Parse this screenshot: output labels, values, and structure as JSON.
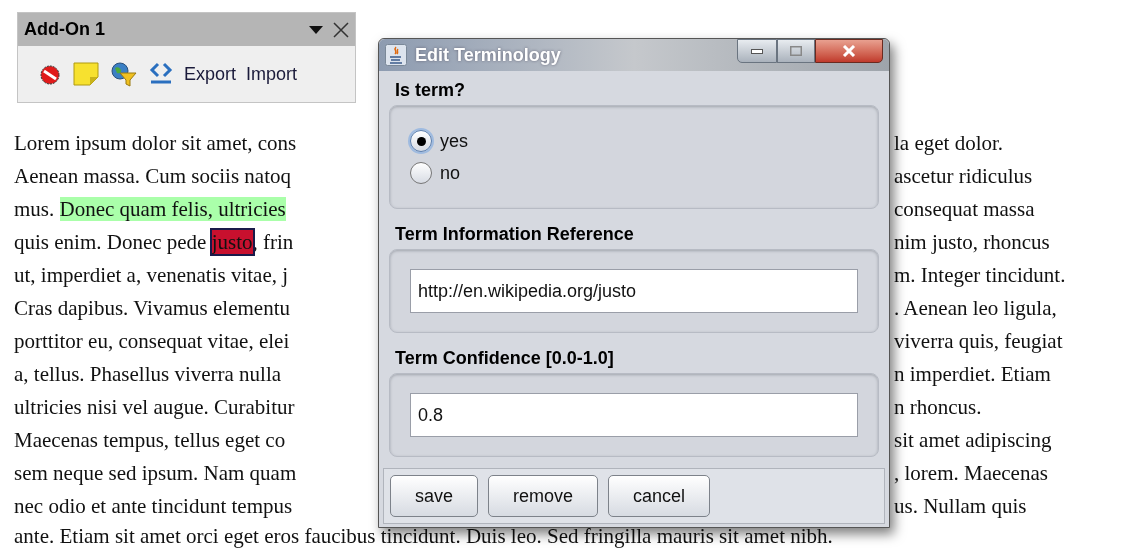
{
  "toolbar": {
    "title": "Add-On 1",
    "text_buttons": [
      "Export",
      "Import"
    ]
  },
  "document": {
    "lines": [
      {
        "segments": [
          {
            "kind": "plain",
            "text": "Lorem ipsum dolor sit amet, cons"
          }
        ],
        "right": "la eget dolor."
      },
      {
        "segments": [
          {
            "kind": "plain",
            "text": "Aenean massa. Cum sociis natoq"
          }
        ],
        "right": "ascetur ridiculus"
      },
      {
        "segments": [
          {
            "kind": "plain",
            "text": "mus. "
          },
          {
            "kind": "highlight",
            "text": "Donec quam felis, ultricies"
          }
        ],
        "right": "consequat massa"
      },
      {
        "segments": [
          {
            "kind": "plain",
            "text": "quis enim. Donec pede "
          },
          {
            "kind": "selected",
            "text": "justo"
          },
          {
            "kind": "plain",
            "text": ", frin"
          }
        ],
        "right": "nim justo, rhoncus"
      },
      {
        "segments": [
          {
            "kind": "plain",
            "text": "ut, imperdiet a, venenatis vitae, j"
          }
        ],
        "right": "m. Integer tincidunt."
      },
      {
        "segments": [
          {
            "kind": "plain",
            "text": "Cras dapibus. Vivamus elementu"
          }
        ],
        "right": ". Aenean leo ligula,"
      },
      {
        "segments": [
          {
            "kind": "plain",
            "text": "porttitor eu, consequat vitae, elei"
          }
        ],
        "right": "viverra quis, feugiat"
      },
      {
        "segments": [
          {
            "kind": "plain",
            "text": "a, tellus. Phasellus viverra nulla"
          }
        ],
        "right": "n imperdiet. Etiam"
      },
      {
        "segments": [
          {
            "kind": "plain",
            "text": "ultricies nisi vel augue. Curabitur"
          }
        ],
        "right": "n rhoncus."
      },
      {
        "segments": [
          {
            "kind": "plain",
            "text": "Maecenas tempus, tellus eget co"
          }
        ],
        "right": "sit amet adipiscing"
      },
      {
        "segments": [
          {
            "kind": "plain",
            "text": "sem neque sed ipsum. Nam quam"
          }
        ],
        "right": ", lorem. Maecenas"
      },
      {
        "segments": [
          {
            "kind": "plain",
            "text": "nec odio et ante tincidunt tempus"
          }
        ],
        "right": "us. Nullam quis"
      },
      {
        "segments": [
          {
            "kind": "plain",
            "text": "ante. Etiam sit amet orci eget eros faucibus tincidunt. Duis leo. Sed fringilla mauris sit amet nibh."
          }
        ]
      }
    ]
  },
  "dialog": {
    "title": "Edit Terminology",
    "sections": [
      {
        "kind": "radio",
        "label": "Is term?",
        "options": [
          {
            "label": "yes",
            "selected": true
          },
          {
            "label": "no",
            "selected": false
          }
        ]
      },
      {
        "kind": "field",
        "label": "Term Information Reference",
        "value": "http://en.wikipedia.org/justo"
      },
      {
        "kind": "field",
        "label": "Term Confidence [0.0-1.0]",
        "value": "0.8"
      }
    ],
    "buttons": [
      "save",
      "remove",
      "cancel"
    ]
  }
}
